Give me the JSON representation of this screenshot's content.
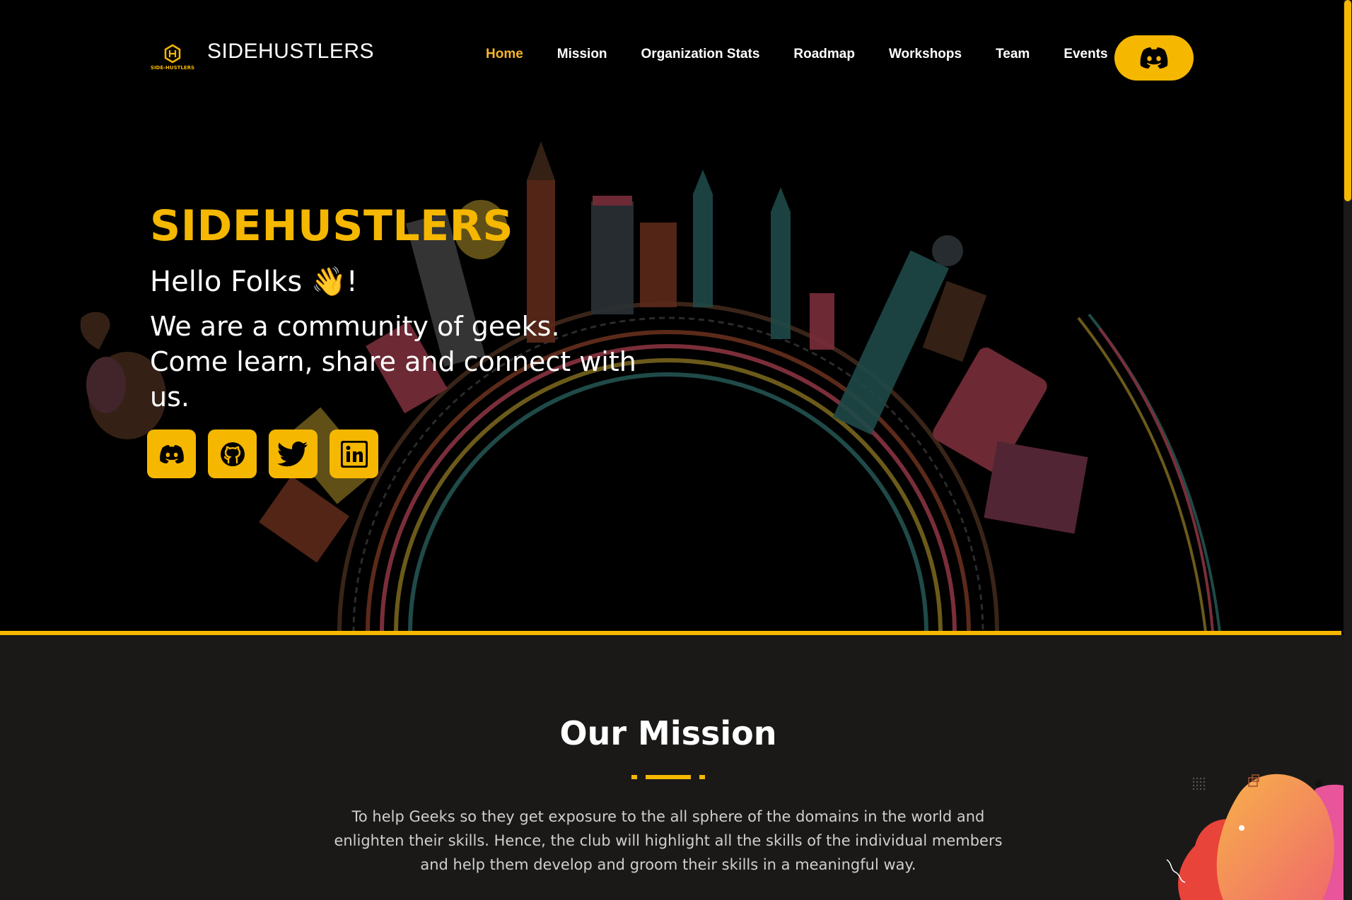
{
  "header": {
    "brand": "SIDEHUSTLERS",
    "logo_text": "SIDE-HUSTLERS",
    "nav": [
      "Home",
      "Mission",
      "Organization Stats",
      "Roadmap",
      "Workshops",
      "Team",
      "Events"
    ],
    "active_nav": "Home",
    "discord_icon": "discord-icon"
  },
  "hero": {
    "title": "SIDEHUSTLERS",
    "greeting": "Hello Folks 👋!",
    "tagline": "We are a community of geeks. Come learn, share and connect with us.",
    "socials": [
      "discord-icon",
      "github-icon",
      "twitter-icon",
      "linkedin-icon"
    ]
  },
  "mission": {
    "title": "Our Mission",
    "text": "To help Geeks so they get exposure to the all sphere of the domains in the world and enlighten their skills. Hence, the club will highlight all the skills of the individual members and help them develop and groom their skills in a meaningful way."
  },
  "colors": {
    "accent": "#f5b700",
    "nav_active": "#f5b42a",
    "background": "#000000",
    "section_bg": "#1a1918"
  }
}
